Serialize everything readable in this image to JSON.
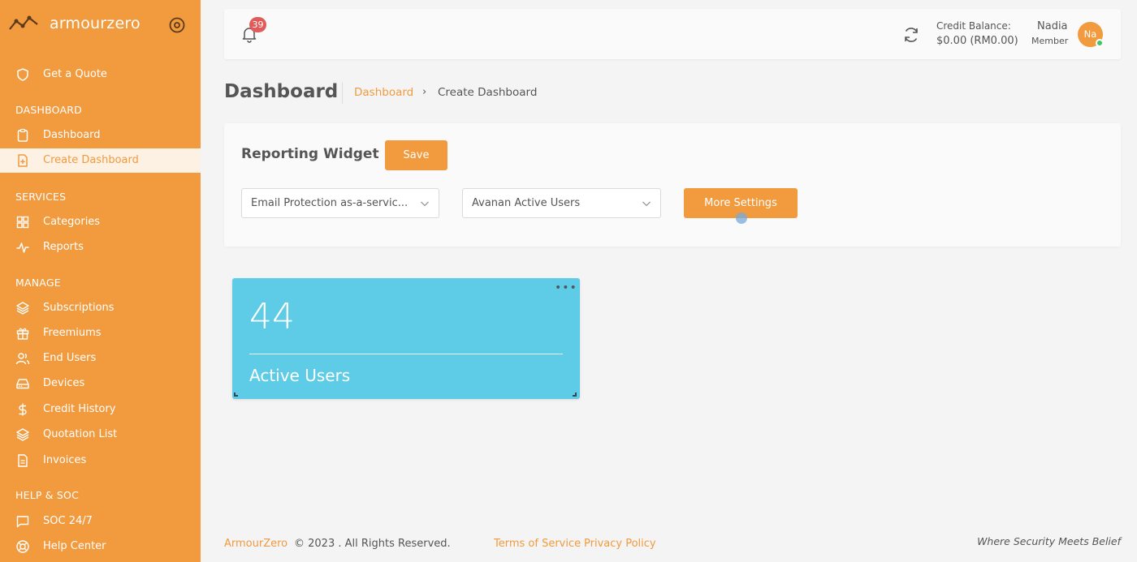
{
  "brand": {
    "name": "armourzero"
  },
  "sidebar": {
    "quote": {
      "label": "Get a Quote",
      "icon": "shield-icon"
    },
    "sections": {
      "dashboard": "DASHBOARD",
      "services": "SERVICES",
      "manage": "MANAGE",
      "help": "HELP & SOC"
    },
    "items": {
      "dashboard": "Dashboard",
      "create_dashboard": "Create Dashboard",
      "categories": "Categories",
      "reports": "Reports",
      "subscriptions": "Subscriptions",
      "freemiums": "Freemiums",
      "end_users": "End Users",
      "devices": "Devices",
      "credit_history": "Credit History",
      "quotation_list": "Quotation List",
      "invoices": "Invoices",
      "soc": "SOC 24/7",
      "help_center": "Help Center"
    },
    "active_item": "Create Dashboard"
  },
  "header": {
    "notification_count": "39",
    "credit_label": "Credit Balance:",
    "credit_value": "$0.00 (RM0.00)",
    "user_name": "Nadia",
    "user_role": "Member",
    "avatar_initials": "Na"
  },
  "page": {
    "title": "Dashboard",
    "breadcrumb_link": "Dashboard",
    "breadcrumb_arrow": "›",
    "breadcrumb_current": "Create Dashboard"
  },
  "widget_panel": {
    "title": "Reporting Widget",
    "save_label": "Save",
    "service_select": "Email Protection as-a-servic...",
    "metric_select": "Avanan Active Users",
    "more_settings_label": "More Settings"
  },
  "stat_widget": {
    "menu": "•••",
    "value": "44",
    "label": "Active Users",
    "color": "#5ecce6"
  },
  "footer": {
    "brand": "ArmourZero",
    "copyright": "© 2023 . All Rights Reserved.",
    "terms": "Terms of Service",
    "privacy": "Privacy Policy",
    "tagline": "Where Security Meets Belief"
  },
  "colors": {
    "accent": "#f19a3e",
    "badge": "#e25b5b",
    "online": "#3ec46d"
  }
}
